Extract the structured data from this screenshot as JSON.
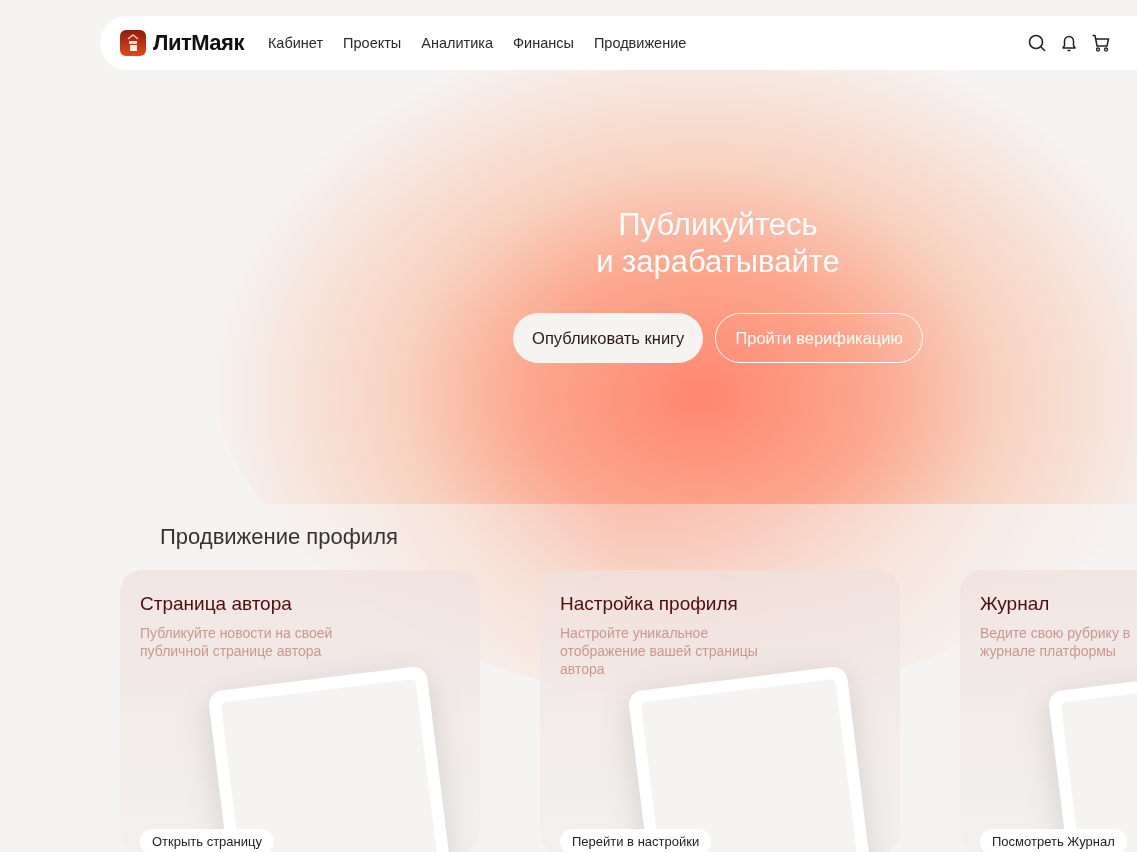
{
  "header": {
    "logo": "ЛитМаяк",
    "nav": [
      {
        "label": "Кабинет"
      },
      {
        "label": "Проекты"
      },
      {
        "label": "Аналитика"
      },
      {
        "label": "Финансы"
      },
      {
        "label": "Продвижение"
      }
    ]
  },
  "hero": {
    "title_lines": [
      "Публикуйтесь",
      "и зарабатывайте"
    ],
    "buttons": [
      {
        "label": "Опубликовать книгу",
        "kind": "filled"
      },
      {
        "label": "Пройти верификацию",
        "kind": "outline"
      }
    ]
  },
  "section": {
    "title": "Продвижение профиля",
    "cards": [
      {
        "title": "Страница автора",
        "description": "Публикуйте новости на своей публичной странице автора",
        "button": "Открыть страницу"
      },
      {
        "title": "Настройка профиля",
        "description": "Настройте уникальное отображение вашей страницы автора",
        "button": "Перейти в настройки"
      },
      {
        "title": "Журнал",
        "description": "Ведите свою рубрику в\nжурнале платформы",
        "button": "Посмотреть Журнал"
      }
    ]
  }
}
